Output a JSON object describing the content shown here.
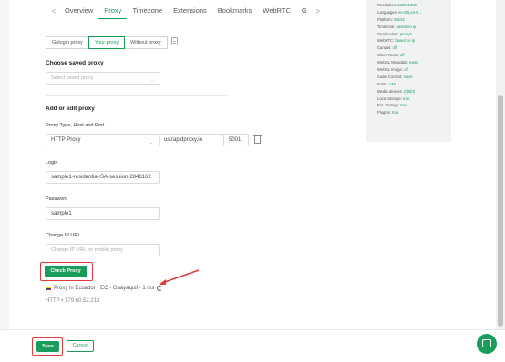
{
  "tabs": [
    "Overview",
    "Proxy",
    "Timezone",
    "Extensions",
    "Bookmarks",
    "WebRTC",
    "G"
  ],
  "proxy_mode": {
    "options": [
      "Gologin proxy",
      "Your proxy",
      "Without proxy"
    ],
    "selected": "Your proxy"
  },
  "saved_proxy": {
    "heading": "Choose saved proxy",
    "placeholder": "Select saved proxy"
  },
  "edit": {
    "heading": "Add or edit proxy",
    "type_label": "Proxy Type, Host and Port",
    "type_value": "HTTP Proxy",
    "host_value": "us.rapidproxy.io",
    "port_value": "5001",
    "login_label": "Login",
    "login_value": "sample1-residential-SA-session-2848162",
    "password_label": "Password",
    "password_value": "sample1",
    "change_ip_label": "Change IP URL",
    "change_ip_placeholder": "Change IP URL for mobile proxy"
  },
  "check": {
    "button": "Check Proxy",
    "result": "Proxy in Ecuador • EC • Guayaquil • 1 ms",
    "ip": "HTTP • 179.60.52.213"
  },
  "overview": [
    {
      "k": "Resolution:",
      "v": "1920x1080"
    },
    {
      "k": "Languages:",
      "v": "en-GB,en-U..."
    },
    {
      "k": "Platform:",
      "v": "Win32"
    },
    {
      "k": "Timezone:",
      "v": "based on ip"
    },
    {
      "k": "Geolocation:",
      "v": "prompt"
    },
    {
      "k": "WebRTC:",
      "v": "based on ip"
    },
    {
      "k": "Canvas:",
      "v": "off"
    },
    {
      "k": "Client Rects:",
      "v": "off"
    },
    {
      "k": "WebGL Metadata:",
      "v": "mask"
    },
    {
      "k": "WebGL Image:",
      "v": "off"
    },
    {
      "k": "Audio Context:",
      "v": "noise"
    },
    {
      "k": "Fonts:",
      "v": "146"
    },
    {
      "k": "Media devices:",
      "v": "(0|0|0)"
    },
    {
      "k": "Local Storage:",
      "v": "true"
    },
    {
      "k": "Ext. Storage:",
      "v": "true"
    },
    {
      "k": "Plugins:",
      "v": "true"
    }
  ],
  "footer": {
    "save": "Save",
    "cancel": "Cancel"
  },
  "colors": {
    "accent": "#1a9c5b",
    "highlight": "#e03a3a"
  }
}
